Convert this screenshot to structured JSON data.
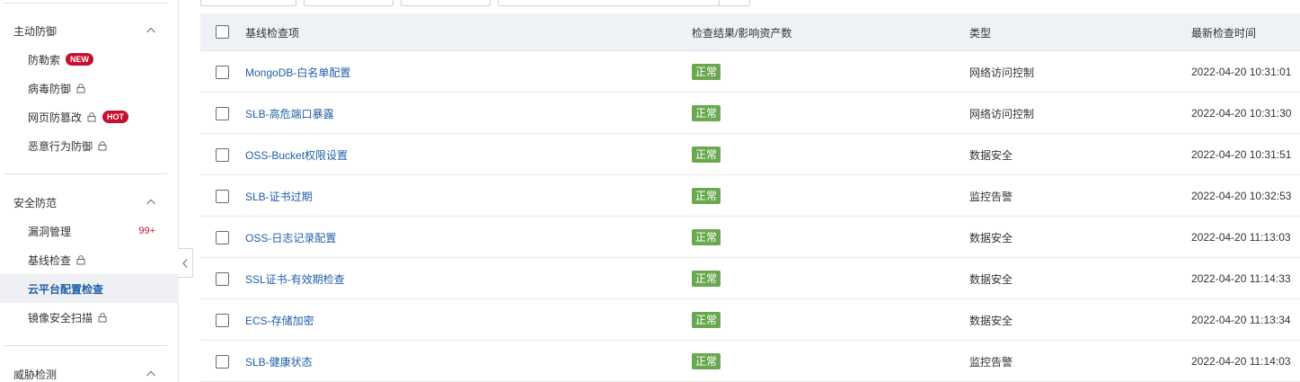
{
  "sidebar": {
    "sections": [
      {
        "label": "主动防御",
        "items": [
          {
            "label": "防勒索",
            "badge": "NEW"
          },
          {
            "label": "病毒防御",
            "locked": true
          },
          {
            "label": "网页防篡改",
            "locked": true,
            "badge": "HOT"
          },
          {
            "label": "恶意行为防御",
            "locked": true
          }
        ]
      },
      {
        "label": "安全防范",
        "items": [
          {
            "label": "漏洞管理",
            "count": "99+"
          },
          {
            "label": "基线检查",
            "locked": true
          },
          {
            "label": "云平台配置检查",
            "active": true
          },
          {
            "label": "镜像安全扫描",
            "locked": true
          }
        ]
      },
      {
        "label": "威胁检测",
        "items": []
      }
    ]
  },
  "table": {
    "headers": {
      "item": "基线检查项",
      "result": "检查结果/影响资产数",
      "type": "类型",
      "time": "最新检查时间"
    },
    "rows": [
      {
        "name": "MongoDB-白名单配置",
        "status": "正常",
        "type": "网络访问控制",
        "time": "2022-04-20 10:31:01"
      },
      {
        "name": "SLB-高危端口暴露",
        "status": "正常",
        "type": "网络访问控制",
        "time": "2022-04-20 10:31:30"
      },
      {
        "name": "OSS-Bucket权限设置",
        "status": "正常",
        "type": "数据安全",
        "time": "2022-04-20 10:31:51"
      },
      {
        "name": "SLB-证书过期",
        "status": "正常",
        "type": "监控告警",
        "time": "2022-04-20 10:32:53"
      },
      {
        "name": "OSS-日志记录配置",
        "status": "正常",
        "type": "数据安全",
        "time": "2022-04-20 11:13:03"
      },
      {
        "name": "SSL证书-有效期检查",
        "status": "正常",
        "type": "数据安全",
        "time": "2022-04-20 11:14:33"
      },
      {
        "name": "ECS-存储加密",
        "status": "正常",
        "type": "数据安全",
        "time": "2022-04-20 11:13:34"
      },
      {
        "name": "SLB-健康状态",
        "status": "正常",
        "type": "监控告警",
        "time": "2022-04-20 11:14:03"
      }
    ]
  },
  "colors": {
    "link": "#1f5fa8",
    "status_ok": "#6aa84f",
    "badge": "#c8102e",
    "header_bg": "#eef1f5",
    "active_bg": "#eef0f4"
  },
  "icons": [
    "chevron-up-icon",
    "lock-icon",
    "chevron-left-icon"
  ]
}
